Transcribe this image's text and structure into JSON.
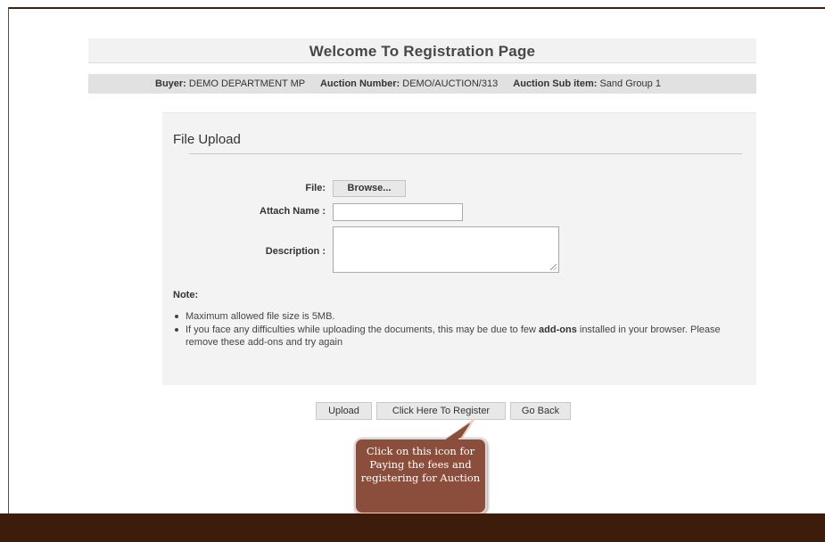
{
  "page": {
    "title": "Welcome To Registration Page"
  },
  "info_bar": {
    "buyer_label": "Buyer:",
    "buyer_value": "DEMO DEPARTMENT MP",
    "auction_number_label": "Auction Number:",
    "auction_number_value": "DEMO/AUCTION/313",
    "sub_item_label": "Auction Sub item:",
    "sub_item_value": "Sand Group 1"
  },
  "upload_panel": {
    "title": "File Upload",
    "file_label": "File:",
    "browse_label": "Browse...",
    "attach_name_label": "Attach Name :",
    "attach_name_value": "",
    "description_label": "Description :",
    "description_value": "",
    "note_label": "Note:",
    "notes": [
      {
        "text": "Maximum allowed file size is 5MB."
      },
      {
        "pre": "If you face any difficulties while uploading the documents, this may be due to few ",
        "bold": "add-ons",
        "post": " installed in your browser. Please remove these add-ons and try again"
      }
    ]
  },
  "actions": {
    "upload_label": "Upload",
    "register_label": "Click Here To Register",
    "go_back_label": "Go Back"
  },
  "callout": {
    "text": "Click on this icon for Paying the fees and registering for Auction"
  },
  "colors": {
    "footer_band": "#3d1c0c",
    "callout_fill": "#8c4e3c",
    "panel_background": "#f3f3f3",
    "info_bar_background": "#e1e1e1"
  }
}
